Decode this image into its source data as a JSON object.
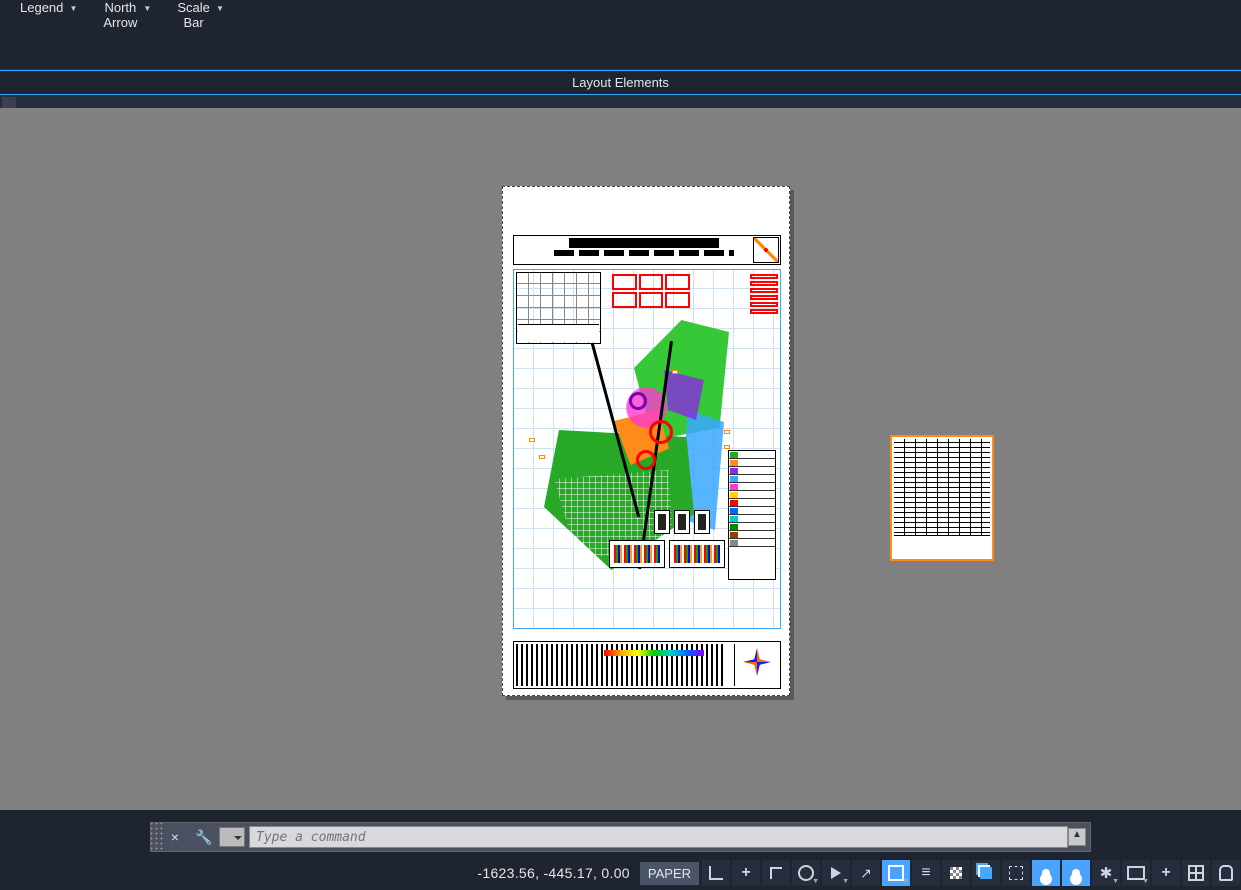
{
  "ribbon": {
    "buttons": [
      {
        "label_top": "Legend",
        "label_bottom": ""
      },
      {
        "label_top": "North",
        "label_bottom": "Arrow"
      },
      {
        "label_top": "Scale",
        "label_bottom": "Bar"
      }
    ],
    "panel_label": "Layout Elements"
  },
  "commandline": {
    "placeholder": "Type a command"
  },
  "statusbar": {
    "coordinates": "-1623.56, -445.17, 0.00",
    "mode": "PAPER",
    "icons": [
      {
        "name": "corner-snap-icon",
        "on": false,
        "dd": false
      },
      {
        "name": "plus-snap-icon",
        "on": false,
        "dd": false
      },
      {
        "name": "perpendicular-icon",
        "on": false,
        "dd": false
      },
      {
        "name": "circle-snap-icon",
        "on": false,
        "dd": true
      },
      {
        "name": "angle-snap-icon",
        "on": false,
        "dd": true
      },
      {
        "name": "linework-icon",
        "on": false,
        "dd": false
      },
      {
        "name": "square-snap-icon",
        "on": true,
        "dd": true
      },
      {
        "name": "lines-menu-icon",
        "on": false,
        "dd": false
      },
      {
        "name": "transparency-icon",
        "on": false,
        "dd": false
      },
      {
        "name": "layers-icon",
        "on": false,
        "dd": false
      },
      {
        "name": "selection-icon",
        "on": false,
        "dd": false
      },
      {
        "name": "person-icon",
        "on": true,
        "dd": false
      },
      {
        "name": "person2-icon",
        "on": true,
        "dd": false
      },
      {
        "name": "gear-icon",
        "on": false,
        "dd": true
      },
      {
        "name": "monitor-icon",
        "on": false,
        "dd": true
      },
      {
        "name": "plus-icon",
        "on": false,
        "dd": false
      },
      {
        "name": "grid-icon",
        "on": false,
        "dd": false
      },
      {
        "name": "db-icon",
        "on": false,
        "dd": false
      }
    ]
  },
  "layout_sheet": {
    "labels": [
      "",
      "",
      "",
      "",
      ""
    ]
  }
}
